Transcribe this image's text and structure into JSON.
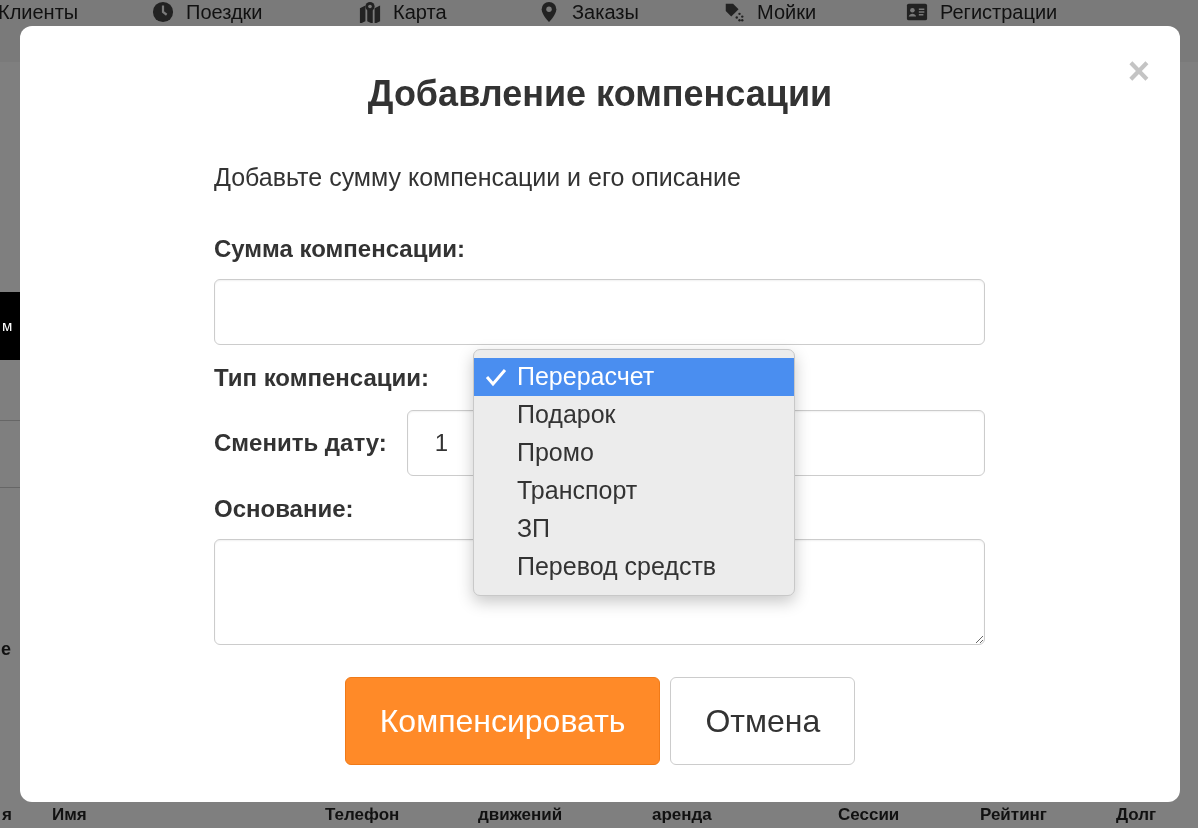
{
  "background_page": {
    "nav": [
      {
        "label": "Клиенты"
      },
      {
        "label": "Поездки"
      },
      {
        "label": "Карта"
      },
      {
        "label": "Заказы"
      },
      {
        "label": "Мойки"
      },
      {
        "label": "Регистрации"
      }
    ],
    "left_edge": [
      {
        "text": "м",
        "kind": "button"
      },
      {
        "text": "е",
        "kind": "text"
      }
    ],
    "table_header": [
      "я",
      "Имя",
      "Телефон",
      "движений",
      "аренда",
      "Сессии",
      "Рейтинг",
      "Долг"
    ]
  },
  "modal": {
    "title": "Добавление компенсации",
    "close": "×",
    "description": "Добавьте сумму компенсации и его описание",
    "sum": {
      "label": "Сумма компенсации:"
    },
    "type": {
      "label": "Тип компенсации:",
      "options": [
        {
          "label": "Перерасчет",
          "selected": true
        },
        {
          "label": "Подарок",
          "selected": false
        },
        {
          "label": "Промо",
          "selected": false
        },
        {
          "label": "Транспорт",
          "selected": false
        },
        {
          "label": "ЗП",
          "selected": false
        },
        {
          "label": "Перевод средств",
          "selected": false
        }
      ]
    },
    "date": {
      "label": "Сменить дату:",
      "value": "1"
    },
    "reason": {
      "label": "Основание:"
    },
    "buttons": [
      {
        "label": "Компенсировать",
        "kind": "primary"
      },
      {
        "label": "Отмена",
        "kind": "secondary"
      }
    ]
  }
}
